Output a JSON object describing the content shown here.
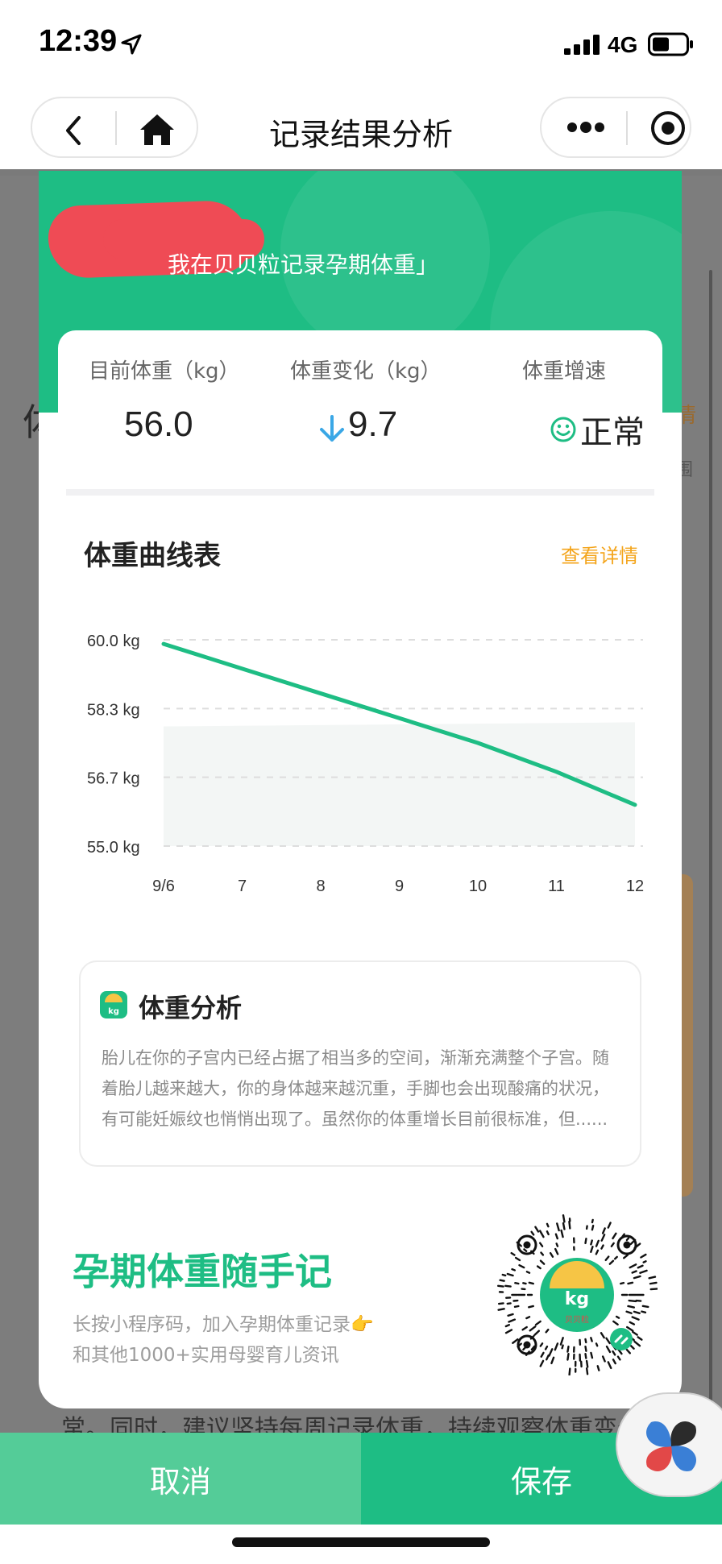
{
  "status_bar": {
    "time": "12:39",
    "network": "4G"
  },
  "nav": {
    "title": "记录结果分析"
  },
  "background": {
    "left_glyph": "体",
    "right_link_glyph": "情",
    "right_small_glyph": "围",
    "bottom_text": "常。同时，建议坚持每周记录体重，持续观察体重变化情况。"
  },
  "card": {
    "header_caption": "我在贝贝粒记录孕期体重」",
    "stats": [
      {
        "label": "目前体重（kg）",
        "value": "56.0"
      },
      {
        "label": "体重变化（kg）",
        "value": "9.7"
      },
      {
        "label": "体重增速",
        "value": "正常"
      }
    ],
    "chart_title": "体重曲线表",
    "chart_link": "查看详情",
    "analysis": {
      "title": "体重分析",
      "icon_text": "kg",
      "text": "胎儿在你的子宫内已经占据了相当多的空间，渐渐充满整个子宫。随着胎儿越来越大，你的身体越来越沉重，手脚也会出现酸痛的状况，有可能妊娠纹也悄悄出现了。虽然你的体重增长目前很标准，但......"
    },
    "promo": {
      "title": "孕期体重随手记",
      "line1": "长按小程序码，加入孕期体重记录👉",
      "line2": "和其他1000+实用母婴育儿资讯",
      "qr_center_text": "kg",
      "qr_brand_text": "贝贝粒"
    }
  },
  "chart_data": {
    "type": "line",
    "x": [
      "9/6",
      "7",
      "8",
      "9",
      "10",
      "11",
      "12"
    ],
    "yticks": [
      "60.0 kg",
      "58.3 kg",
      "56.7 kg",
      "55.0 kg"
    ],
    "ylim": [
      55.0,
      60.0
    ],
    "series": [
      {
        "values": [
          59.9,
          59.3,
          58.7,
          58.1,
          57.5,
          56.8,
          56.0
        ]
      }
    ],
    "reference_band": [
      55.0,
      57.9,
      58.0
    ],
    "colors": {
      "line": "#1ebd84",
      "band": "#f3f6f5",
      "grid": "#dddddd"
    }
  },
  "buttons": {
    "cancel": "取消",
    "save": "保存"
  },
  "colors": {
    "brand": "#1ebd84",
    "accent": "#f4a51c",
    "cancel": "#54cc98"
  }
}
